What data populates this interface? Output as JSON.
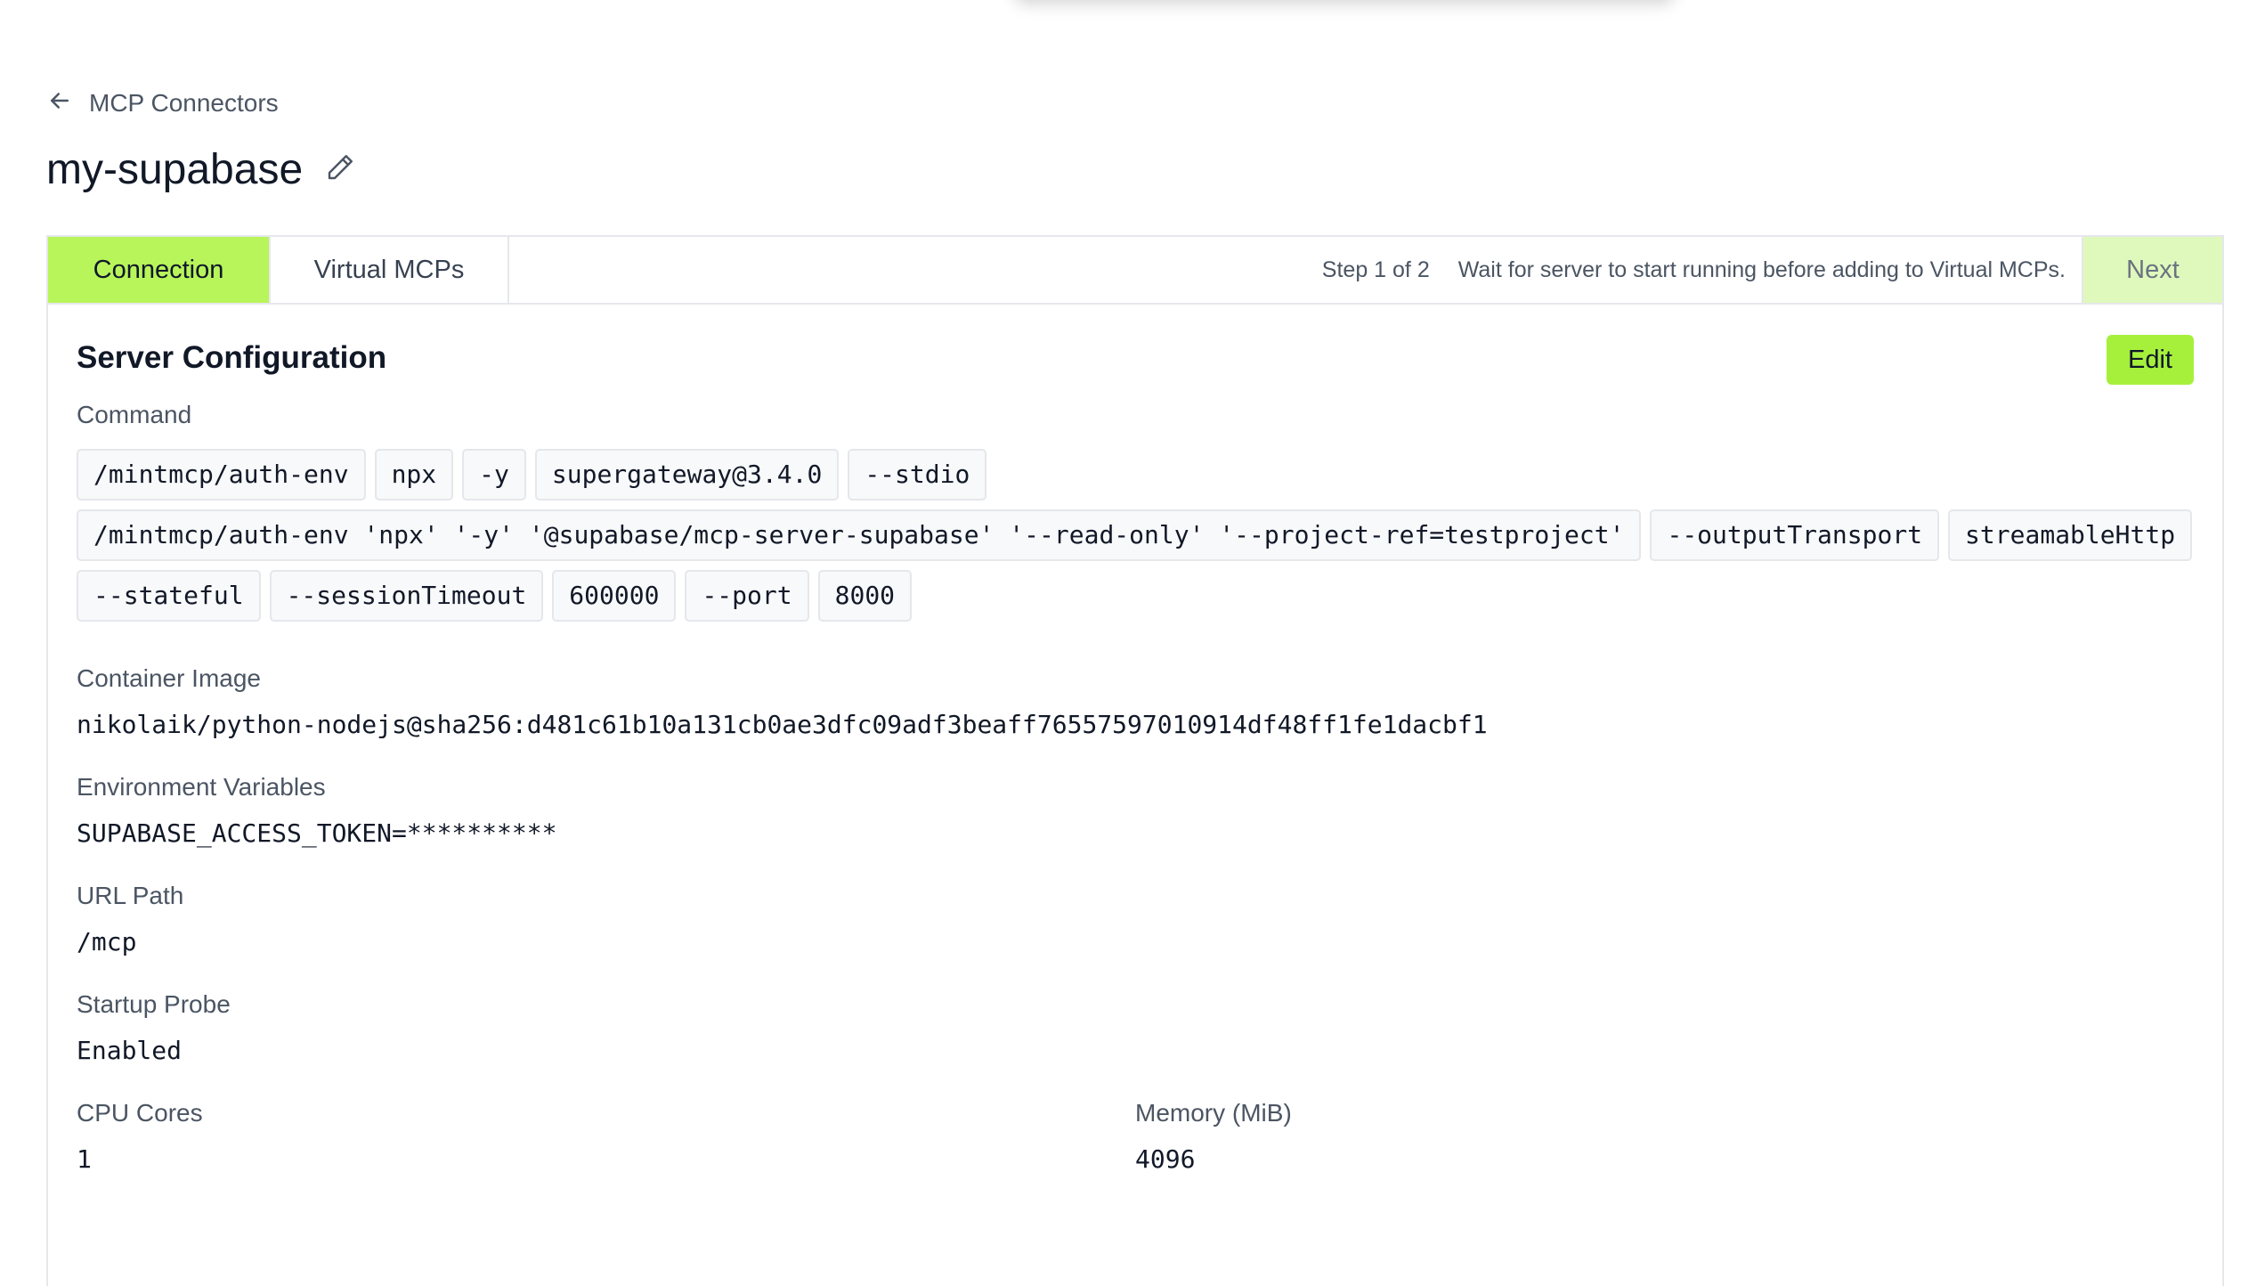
{
  "breadcrumb": {
    "label": "MCP Connectors"
  },
  "page": {
    "title": "my-supabase"
  },
  "tabs": [
    {
      "label": "Connection",
      "active": true
    },
    {
      "label": "Virtual MCPs",
      "active": false
    }
  ],
  "wizard": {
    "step": "Step 1 of 2",
    "hint": "Wait for server to start running before adding to Virtual MCPs.",
    "next_label": "Next"
  },
  "server_config": {
    "title": "Server Configuration",
    "edit_label": "Edit",
    "command_label": "Command",
    "command_parts": [
      "/mintmcp/auth-env",
      "npx",
      "-y",
      "supergateway@3.4.0",
      "--stdio",
      "/mintmcp/auth-env 'npx' '-y' '@supabase/mcp-server-supabase' '--read-only' '--project-ref=testproject'",
      "--outputTransport",
      "streamableHttp",
      "--stateful",
      "--sessionTimeout",
      "600000",
      "--port",
      "8000"
    ],
    "container_image_label": "Container Image",
    "container_image": "nikolaik/python-nodejs@sha256:d481c61b10a131cb0ae3dfc09adf3beaff76557597010914df48ff1fe1dacbf1",
    "env_label": "Environment Variables",
    "env_value": "SUPABASE_ACCESS_TOKEN=**********",
    "url_path_label": "URL Path",
    "url_path": "/mcp",
    "startup_probe_label": "Startup Probe",
    "startup_probe": "Enabled",
    "cpu_label": "CPU Cores",
    "cpu_value": "1",
    "memory_label": "Memory (MiB)",
    "memory_value": "4096"
  },
  "colors": {
    "accent": "#a6f03c",
    "active_tab": "#b8f55a",
    "next_disabled": "#dff9bd"
  }
}
